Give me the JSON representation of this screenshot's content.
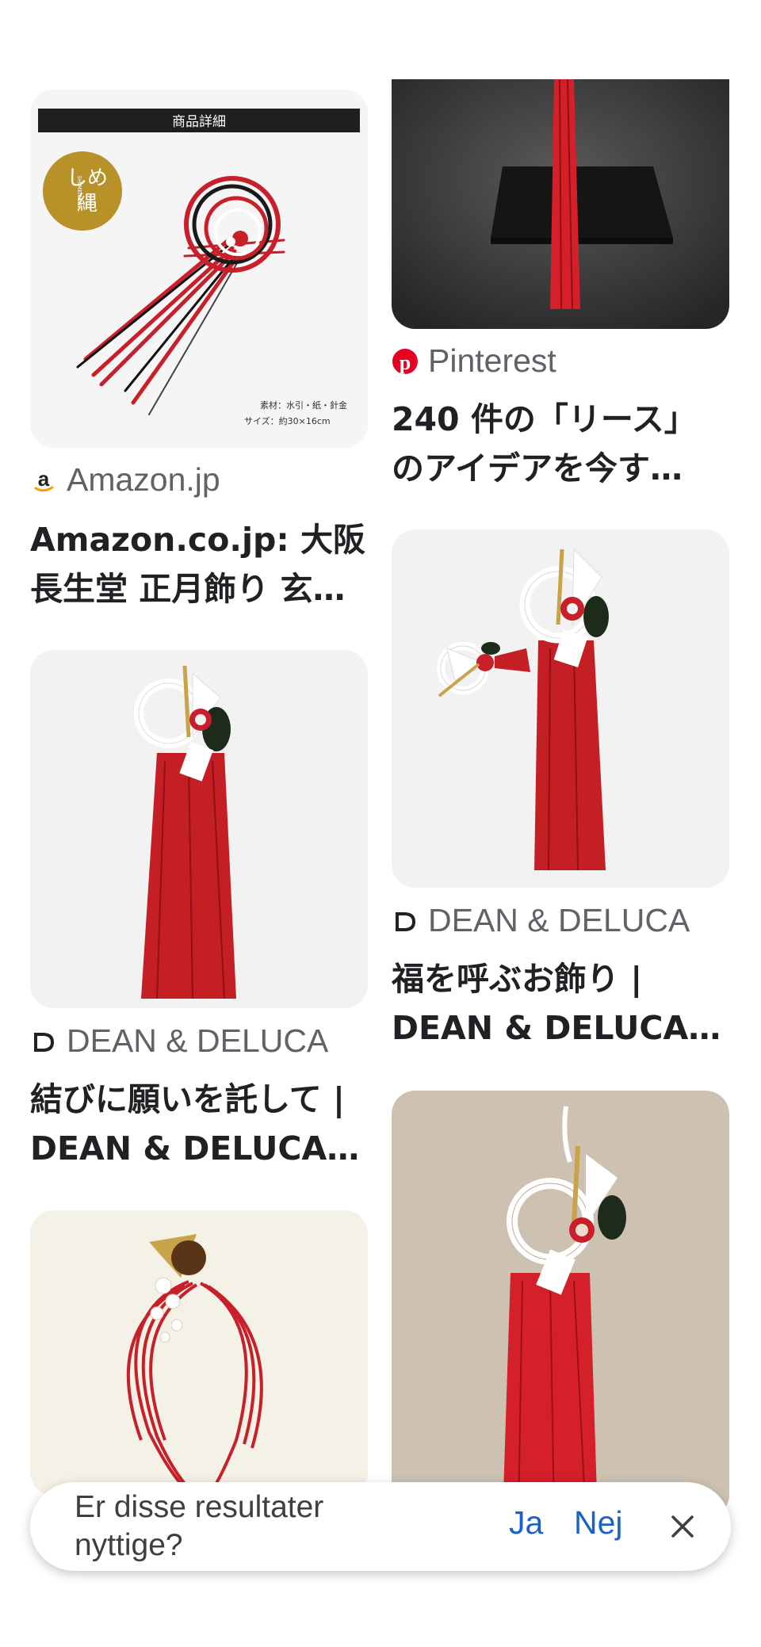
{
  "results": [
    {
      "source": "Amazon.jp",
      "favicon": "amazon-icon",
      "title_line1": "Amazon.co.jp: 大阪",
      "title_line2": "長生堂 正月飾り 玄…",
      "image_label": "商品詳細",
      "image_badge_line1": "しめ",
      "image_badge_line2": "縄",
      "image_badge_sub": "SHIMENAWA",
      "image_caption1": "素材：水引・紙・針金",
      "image_caption2": "サイズ：約30×16cm"
    },
    {
      "source": "Pinterest",
      "favicon": "pinterest-icon",
      "title_line1": "240 件の「リース」",
      "title_line2": "のアイデアを今す…"
    },
    {
      "source": "DEAN & DELUCA",
      "favicon": "dean-deluca-icon",
      "title_line1": "結びに願いを託して |",
      "title_line2": "DEAN & DELUCA…"
    },
    {
      "source": "DEAN & DELUCA",
      "favicon": "dean-deluca-icon",
      "title_line1": "福を呼ぶお飾り |",
      "title_line2": "DEAN & DELUCA…"
    }
  ],
  "feedback": {
    "question": "Er disse resultater nyttige?",
    "yes": "Ja",
    "no": "Nej",
    "close_icon": "close-icon"
  },
  "colors": {
    "accent_blue": "#1a62c9",
    "pinterest_red": "#e60023",
    "amazon_orange": "#ff9900",
    "cord_red": "#c8202a"
  }
}
